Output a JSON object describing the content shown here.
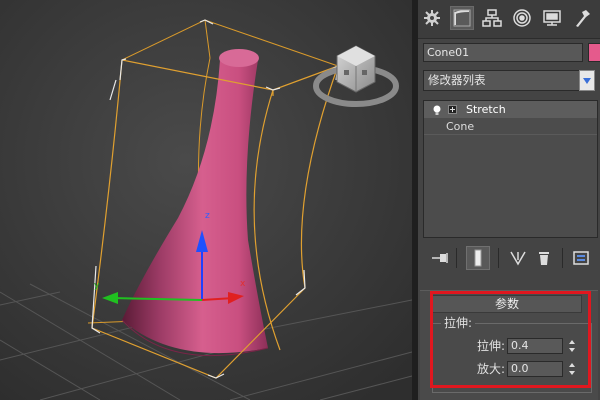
{
  "viewport": {
    "gizmo_labels": {
      "z": "z",
      "x": "x",
      "y": "y"
    }
  },
  "command_panel": {
    "tabs": [
      "create-tab",
      "modify-tab",
      "hierarchy-tab",
      "motion-tab",
      "display-tab",
      "utilities-tab"
    ],
    "object_name": "Cone01",
    "object_color": "#e55a8c",
    "modifier_list_label": "修改器列表",
    "modifier_stack": [
      {
        "name": "Stretch",
        "selected": true
      },
      {
        "name": "Cone",
        "selected": false
      }
    ]
  },
  "parameters_rollout": {
    "title": "参数",
    "group_label": "拉伸:",
    "fields": [
      {
        "label": "拉伸:",
        "value": "0.4"
      },
      {
        "label": "放大:",
        "value": "0.0"
      }
    ]
  },
  "highlight_color": "#e0171f"
}
